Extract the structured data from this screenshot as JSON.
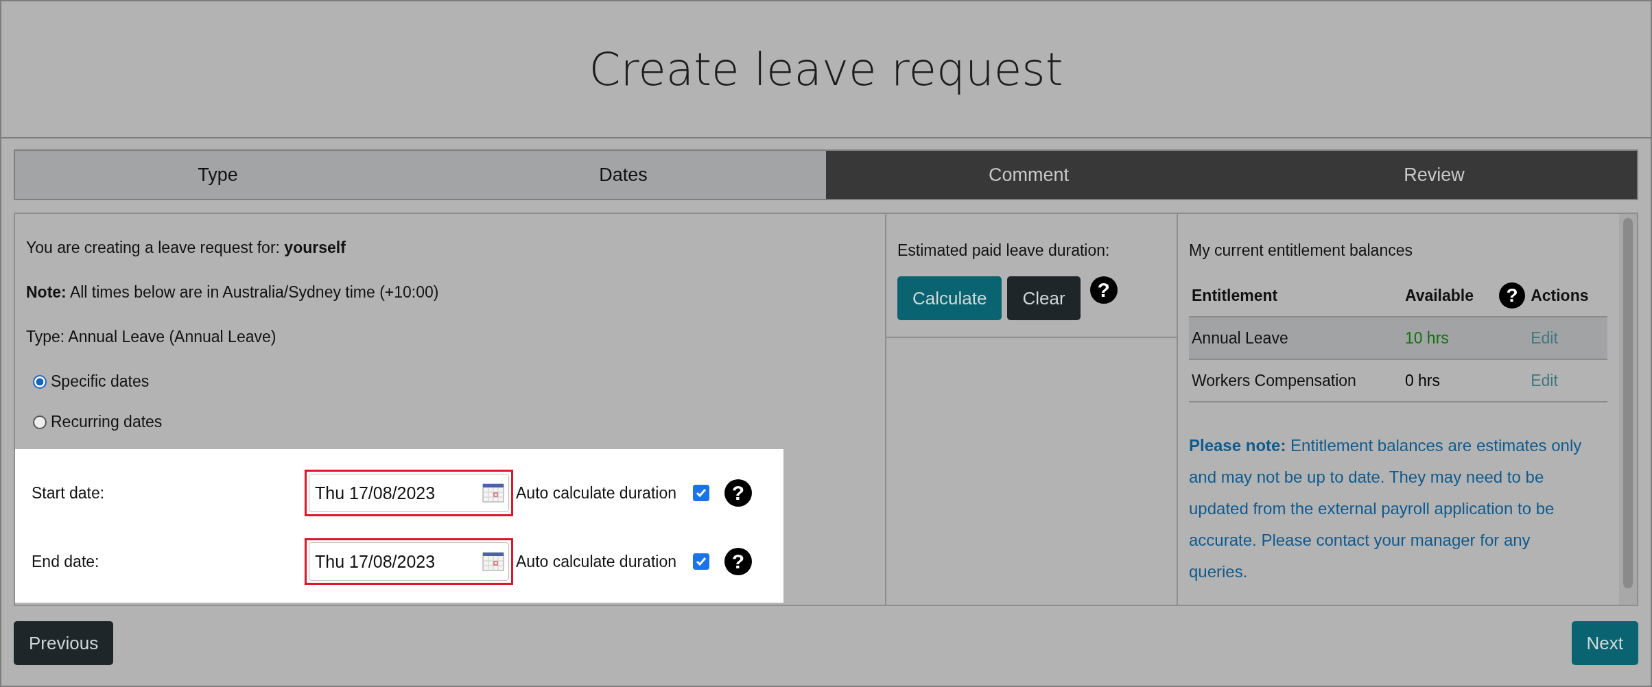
{
  "page": {
    "title": "Create leave request"
  },
  "steps": [
    {
      "label": "Type",
      "completed": true
    },
    {
      "label": "Dates",
      "completed": true
    },
    {
      "label": "Comment",
      "completed": false
    },
    {
      "label": "Review",
      "completed": false
    }
  ],
  "details": {
    "intro": "You are creating a leave request for: **yourself**",
    "note": "**Note:** All times below are in Australia/Sydney time (+10:00)",
    "type_line": "Type: Annual Leave (Annual Leave)"
  },
  "date_mode": [
    {
      "label": "Specific dates",
      "selected": true
    },
    {
      "label": "Recurring dates",
      "selected": false
    }
  ],
  "date_fields": [
    {
      "label": "Start date:",
      "value": "Thu 17/08/2023",
      "highlighted": true,
      "auto_label": "Auto calculate duration",
      "checked": true,
      "help": "?"
    },
    {
      "label": "End date:",
      "value": "Thu 17/08/2023",
      "highlighted": true,
      "auto_label": "Auto calculate duration",
      "checked": true,
      "help": "?"
    }
  ],
  "estimate": {
    "label": "Estimated paid leave duration:",
    "buttons": [
      {
        "label": "Calculate",
        "kind": "primary"
      },
      {
        "label": "Clear",
        "kind": "dark"
      }
    ],
    "help": "?"
  },
  "balances": {
    "title": "My current entitlement balances",
    "columns": [
      "Entitlement",
      "Available",
      "Actions"
    ],
    "help": "?",
    "rows": [
      {
        "entitlement": "Annual Leave",
        "available": "10 hrs",
        "action": "Edit",
        "selected": true,
        "color": "#137013"
      },
      {
        "entitlement": "Workers Compensation",
        "available": "0 hrs",
        "action": "Edit",
        "selected": false,
        "color": "#000000"
      }
    ],
    "note": "**Please note:** Entitlement balances are estimates only and may not be up to date. They may need to be updated from the external payroll application to be accurate. Please contact your manager for any queries."
  },
  "footer": {
    "previous": "Previous",
    "next": "Next"
  }
}
